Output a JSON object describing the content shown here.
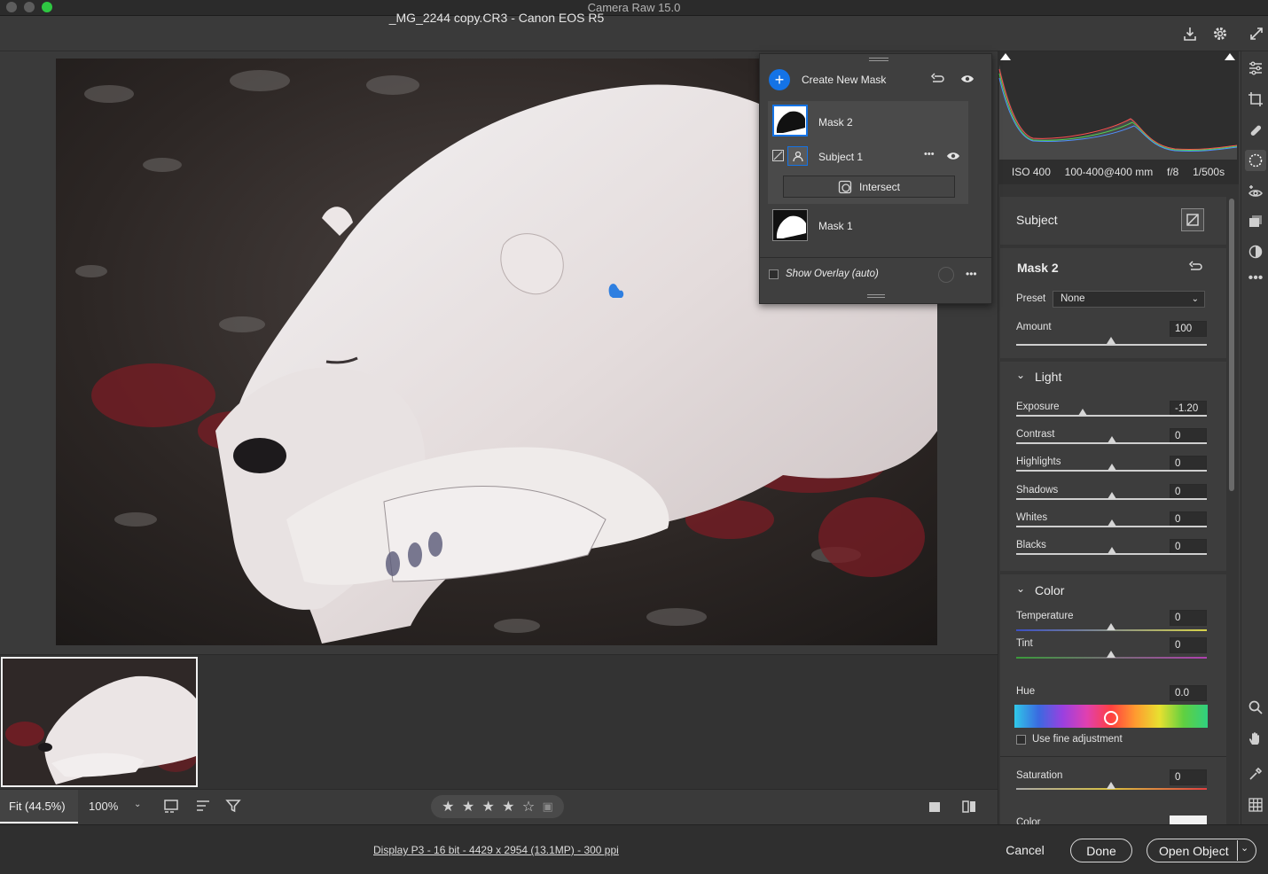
{
  "window": {
    "app_title": "Camera Raw 15.0"
  },
  "header": {
    "file_title": "_MG_2244 copy.CR3  -  Canon EOS R5"
  },
  "exif": {
    "iso": "ISO 400",
    "lens": "100-400@400 mm",
    "aperture": "f/8",
    "shutter": "1/500s"
  },
  "masks": {
    "create_label": "Create New Mask",
    "mask2_label": "Mask 2",
    "subject1_label": "Subject 1",
    "intersect_label": "Intersect",
    "mask1_label": "Mask 1",
    "overlay_label": "Show Overlay (auto)"
  },
  "panel": {
    "subject_title": "Subject",
    "mask_title": "Mask 2",
    "preset_label": "Preset",
    "preset_value": "None",
    "amount_label": "Amount",
    "amount_value": "100",
    "light_title": "Light",
    "color_title": "Color",
    "light": [
      {
        "label": "Exposure",
        "value": "-1.20",
        "level": 0.35
      },
      {
        "label": "Contrast",
        "value": "0",
        "level": 0.5
      },
      {
        "label": "Highlights",
        "value": "0",
        "level": 0.5
      },
      {
        "label": "Shadows",
        "value": "0",
        "level": 0.5
      },
      {
        "label": "Whites",
        "value": "0",
        "level": 0.5
      },
      {
        "label": "Blacks",
        "value": "0",
        "level": 0.5
      }
    ],
    "temperature_label": "Temperature",
    "temperature_value": "0",
    "tint_label": "Tint",
    "tint_value": "0",
    "hue_label": "Hue",
    "hue_value": "0.0",
    "fine_label": "Use fine adjustment",
    "saturation_label": "Saturation",
    "saturation_value": "0",
    "color_label": "Color"
  },
  "bottombar": {
    "zoom_fit": "Fit (44.5%)",
    "zoom_pct": "100%",
    "rating": 4,
    "rating_max": 5
  },
  "footer": {
    "display_info": "Display P3 - 16 bit - 4429 x 2954 (13.1MP) - 300 ppi",
    "cancel": "Cancel",
    "done": "Done",
    "open_object": "Open Object"
  },
  "colors": {
    "accent": "#1473e6",
    "hue_marker": "#ffffff",
    "close_light": "#2ec742"
  }
}
